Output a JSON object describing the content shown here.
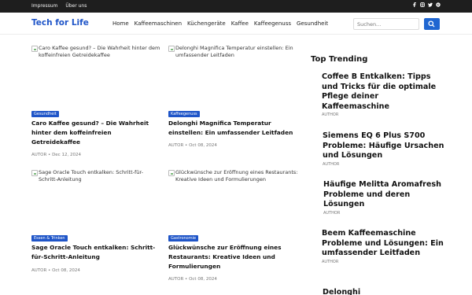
{
  "topbar": {
    "links": [
      "Impressum",
      "Über uns"
    ],
    "social": [
      "facebook-icon",
      "instagram-icon",
      "twitter-icon",
      "pinterest-icon"
    ]
  },
  "header": {
    "logo": "Tech for Life",
    "nav": [
      "Home",
      "Kaffeemaschinen",
      "Küchengeräte",
      "Kaffee",
      "Kaffeegenuss",
      "Gesundheit"
    ],
    "search_placeholder": "Suchen..."
  },
  "posts": [
    {
      "image_alt": "Caro Kaffee gesund? – Die Wahrheit hinter dem koffeinfreien Getreidekaffee",
      "category": "Gesundheit",
      "category_color": "#1f55c8",
      "title": "Caro Kaffee gesund? – Die Wahrheit hinter dem koffeinfreien Getreidekaffee",
      "author": "AUTOR",
      "date": "Dec 12, 2024"
    },
    {
      "image_alt": "Delonghi Magnifica Temperatur einstellen: Ein umfassender Leitfaden",
      "category": "Kaffeegenuss",
      "category_color": "#1f55c8",
      "title": "Delonghi Magnifica Temperatur einstellen: Ein umfassender Leitfaden",
      "author": "AUTOR",
      "date": "Oct 08, 2024"
    },
    {
      "image_alt": "Sage Oracle Touch entkalken: Schritt-für-Schritt-Anleitung",
      "category": "Essen & Trinken",
      "category_color": "#1f55c8",
      "title": "Sage Oracle Touch entkalken: Schritt-für-Schritt-Anleitung",
      "author": "AUTOR",
      "date": "Oct 08, 2024"
    },
    {
      "image_alt": "Glückwünsche zur Eröffnung eines Restaurants: Kreative Ideen und Formulierungen",
      "category": "Gastronomie",
      "category_color": "#1f55c8",
      "title": "Glückwünsche zur Eröffnung eines Restaurants: Kreative Ideen und Formulierungen",
      "author": "AUTOR",
      "date": "Oct 08, 2024"
    }
  ],
  "trending": {
    "heading": "Top Trending",
    "items": [
      {
        "title": "Coffee B Entkalken: Tipps und Tricks für die optimale Pflege deiner Kaffeemaschine",
        "author": "AUTHOR"
      },
      {
        "title": "Siemens EQ 6 Plus S700 Probleme: Häufige Ursachen und Lösungen",
        "author": "AUTHOR"
      },
      {
        "title": "Häufige Melitta Aromafresh Probleme und deren Lösungen",
        "author": "AUTHOR"
      },
      {
        "title": "Beem Kaffeemaschine Probleme und Lösungen: Ein umfassender Leitfaden",
        "author": "AUTHOR"
      },
      {
        "title": "Delonghi",
        "author": ""
      }
    ]
  }
}
